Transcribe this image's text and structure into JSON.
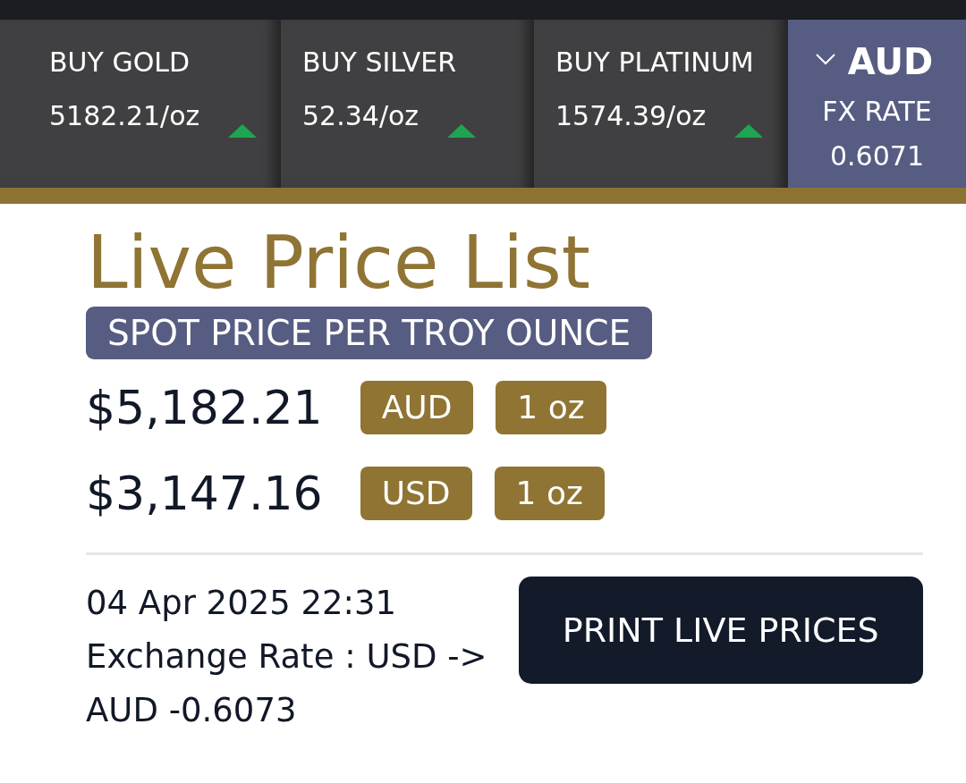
{
  "ticker": [
    {
      "label": "BUY GOLD",
      "price": "5182.21/oz",
      "rising": true
    },
    {
      "label": "BUY SILVER",
      "price": "52.34/oz",
      "rising": true
    },
    {
      "label": "BUY PLATINUM",
      "price": "1574.39/oz",
      "rising": true
    }
  ],
  "currency": {
    "code": "AUD",
    "fx_label": "FX RATE",
    "fx_rate": "0.6071"
  },
  "title": "Live Price List",
  "subtitle": "SPOT PRICE PER TROY OUNCE",
  "prices": [
    {
      "amount": "$5,182.21",
      "currency": "AUD",
      "unit": "1 oz"
    },
    {
      "amount": "$3,147.16",
      "currency": "USD",
      "unit": "1 oz"
    }
  ],
  "updated": "04 Apr 2025 22:31",
  "exchange_rate": "Exchange Rate : USD -> AUD -0.6073",
  "print_button": "PRINT LIVE PRICES"
}
